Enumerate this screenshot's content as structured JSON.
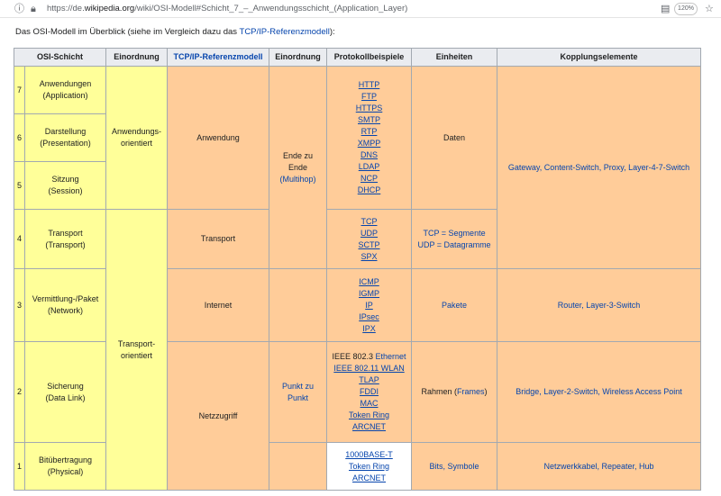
{
  "browser": {
    "url_prefix": "https://de.",
    "url_domain": "wikipedia.org",
    "url_path": "/wiki/OSI-Modell#Schicht_7_–_Anwendungsschicht_(Application_Layer)",
    "zoom": "120%"
  },
  "intro": {
    "text_before": "Das OSI-Modell im Überblick (siehe im Vergleich dazu das ",
    "link": "TCP/IP-Referenzmodell",
    "text_after": "):"
  },
  "table": {
    "headers": {
      "osi": "OSI-Schicht",
      "einordnung1": "Einordnung",
      "tcpip": "TCP/IP-Referenzmodell",
      "einordnung2": "Einordnung",
      "protokolle": "Protokollbeispiele",
      "einheiten": "Einheiten",
      "kopplung": "Kopplungselemente"
    },
    "layers": {
      "l7": {
        "num": "7",
        "name": "Anwendungen",
        "en": "(Application)"
      },
      "l6": {
        "num": "6",
        "name": "Darstellung",
        "en": "(Presentation)"
      },
      "l5": {
        "num": "5",
        "name": "Sitzung",
        "en": "(Session)"
      },
      "l4": {
        "num": "4",
        "name": "Transport",
        "en": "(Transport)"
      },
      "l3": {
        "num": "3",
        "name": "Vermittlung-/Paket",
        "en": "(Network)"
      },
      "l2": {
        "num": "2",
        "name": "Sicherung",
        "en": "(Data Link)"
      },
      "l1": {
        "num": "1",
        "name": "Bitübertragung",
        "en": "(Physical)"
      }
    },
    "einordnung": {
      "anwendung_a": "Anwendungs-",
      "anwendung_b": "orientiert",
      "transport_a": "Transport-",
      "transport_b": "orientiert"
    },
    "tcpip": {
      "anwendung": "Anwendung",
      "transport": "Transport",
      "internet": "Internet",
      "netzzugriff": "Netzzugriff"
    },
    "einordnung2": {
      "e2e_a": "Ende zu",
      "e2e_b": "Ende",
      "multihop": "(Multihop)",
      "p2p_a": "Punkt zu",
      "p2p_b": "Punkt"
    },
    "protocols": {
      "app": [
        "HTTP",
        "FTP",
        "HTTPS",
        "SMTP",
        "RTP",
        "XMPP",
        "DNS",
        "LDAP",
        "NCP",
        "DHCP"
      ],
      "transport": [
        "TCP",
        "UDP",
        "SCTP",
        "SPX"
      ],
      "network": [
        "ICMP",
        "IGMP",
        "IP",
        "IPsec",
        "IPX"
      ],
      "datalink_l1a": "IEEE 802.3 ",
      "datalink_l1b": "Ethernet",
      "datalink": [
        "IEEE 802.11 WLAN",
        "TLAP",
        "FDDI",
        "MAC",
        "Token Ring",
        "ARCNET"
      ],
      "physical": [
        "1000BASE-T",
        "Token Ring",
        "ARCNET"
      ]
    },
    "units": {
      "daten": "Daten",
      "tcp_seg": "TCP = Segmente",
      "udp_dg": "UDP = Datagramme",
      "pakete": "Pakete",
      "rahmen_a": "Rahmen (",
      "rahmen_link": "Frames",
      "rahmen_b": ")",
      "bits": "Bits, Symbole"
    },
    "devices": {
      "top": "Gateway, Content-Switch, Proxy, Layer-4-7-Switch",
      "l3": "Router, Layer-3-Switch",
      "l2": "Bridge, Layer-2-Switch, Wireless Access Point",
      "l1": "Netzwerkkabel, Repeater, Hub"
    }
  }
}
